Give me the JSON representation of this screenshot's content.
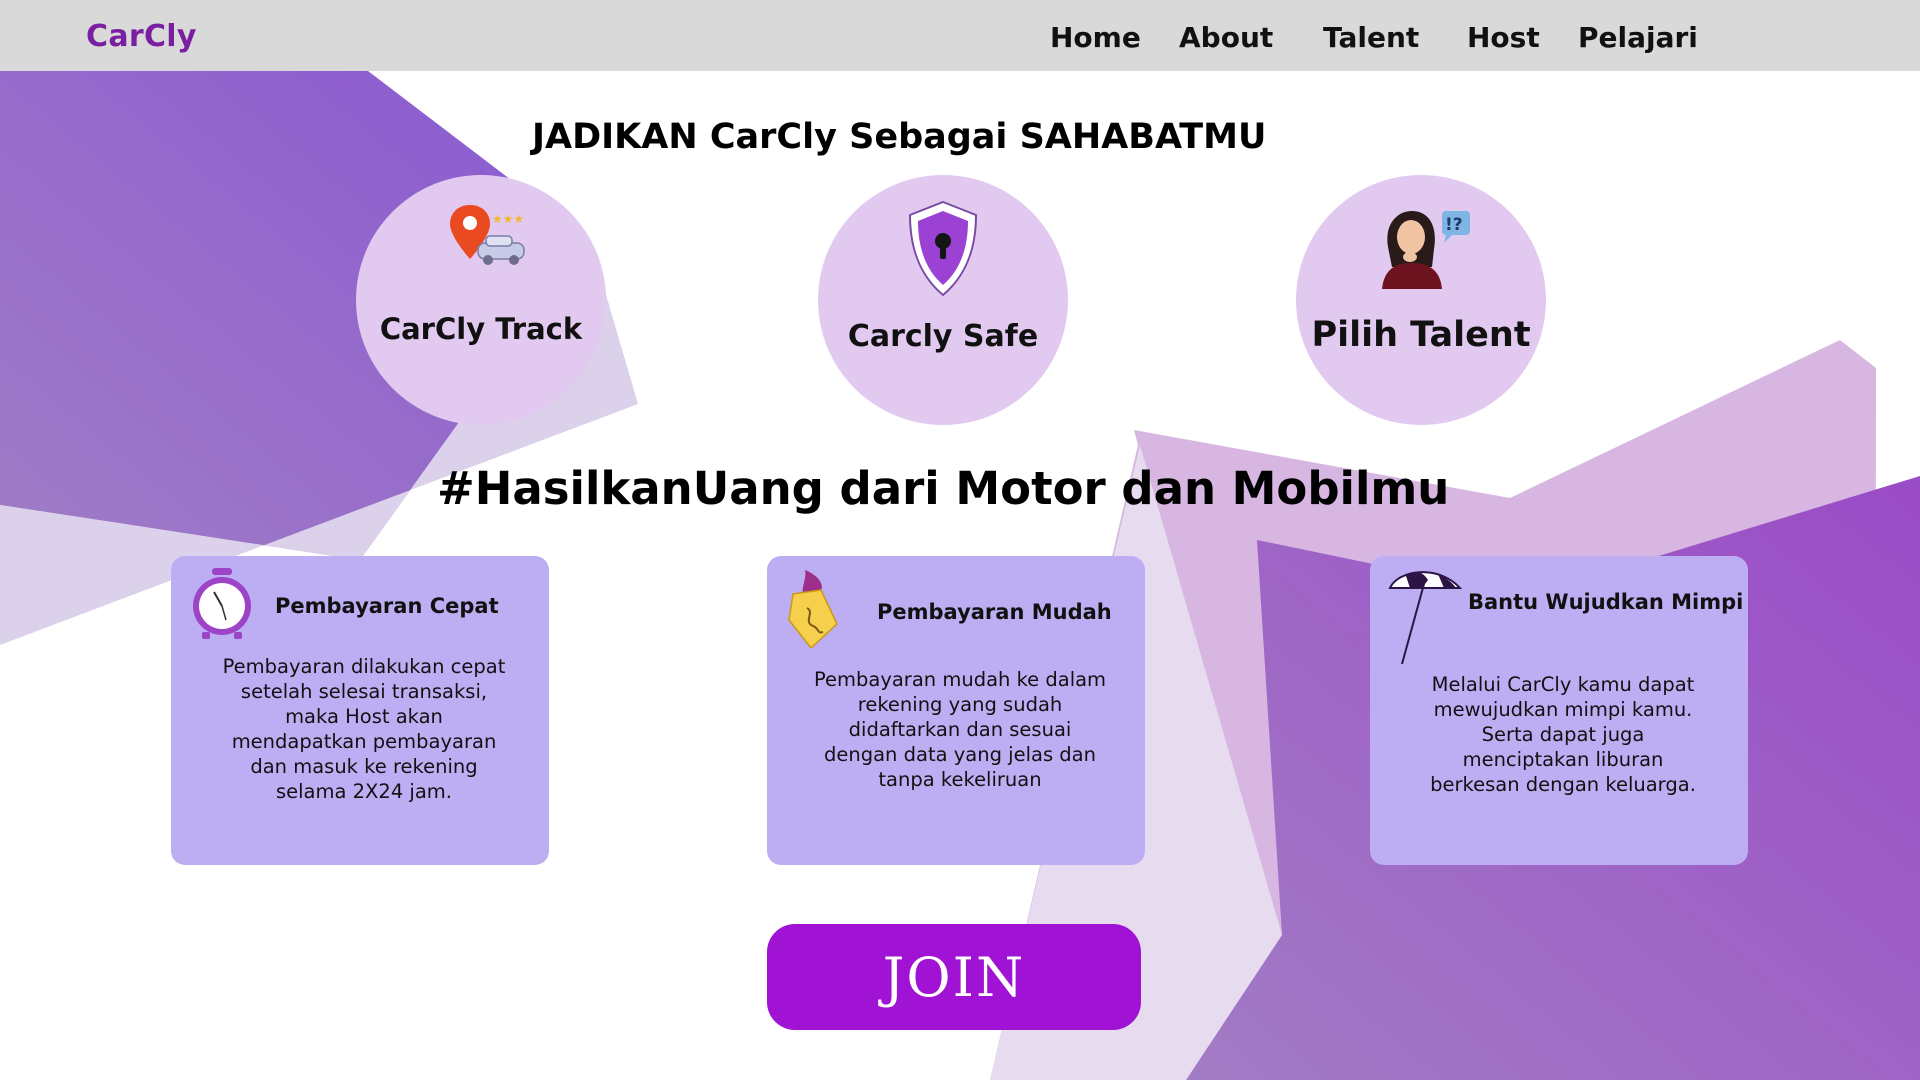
{
  "brand": "CarCly",
  "nav": [
    "Home",
    "About",
    "Talent",
    "Host",
    "Pelajari"
  ],
  "headline": "JADIKAN CarCly Sebagai SAHABATMU",
  "features": [
    {
      "label": "CarCly Track",
      "icon": "location-pin-car-icon"
    },
    {
      "label": "Carcly Safe",
      "icon": "shield-lock-icon"
    },
    {
      "label": "Pilih Talent",
      "icon": "thinking-woman-icon"
    }
  ],
  "subheadline": "#HasilkanUang dari Motor dan Mobilmu",
  "cards": [
    {
      "title": "Pembayaran Cepat",
      "icon": "alarm-clock-icon",
      "lines": [
        "Pembayaran dilakukan cepat",
        "setelah selesai transaksi,",
        "maka Host akan",
        "mendapatkan pembayaran",
        "dan masuk ke rekening",
        "selama 2X24 jam."
      ]
    },
    {
      "title": "Pembayaran Mudah",
      "icon": "money-note-icon",
      "lines": [
        "Pembayaran mudah ke dalam",
        "rekening yang sudah",
        "didaftarkan dan sesuai",
        "dengan data yang jelas dan",
        "tanpa kekeliruan"
      ]
    },
    {
      "title": "Bantu Wujudkan Mimpi",
      "icon": "beach-umbrella-icon",
      "lines": [
        "Melalui CarCly kamu dapat",
        "mewujudkan mimpi kamu.",
        "Serta dapat juga",
        "menciptakan liburan",
        "berkesan dengan keluarga."
      ]
    }
  ],
  "join_label": "JOIN",
  "colors": {
    "brand": "#7b1fa2",
    "nav_bg": "#d9d9d9",
    "circle": "#e2c9f0",
    "card": "#bdaef4",
    "join": "#a012d4"
  }
}
